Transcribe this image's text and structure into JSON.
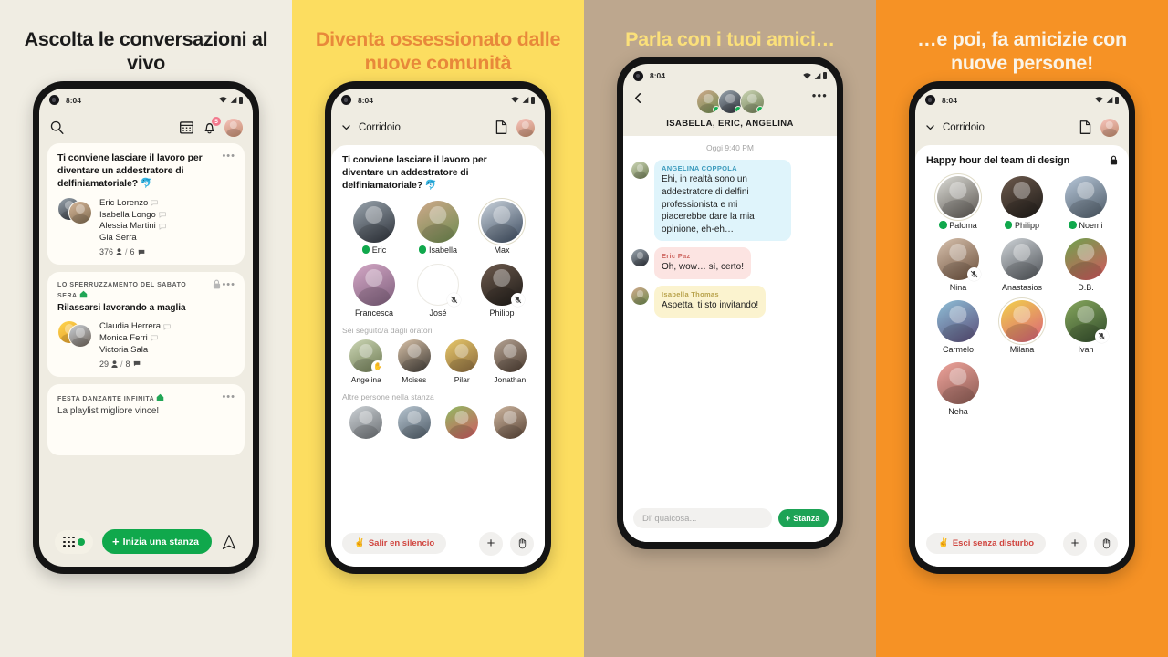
{
  "panels": [
    {
      "id": "panel-listen",
      "background": "#f0ede3",
      "headline": "Ascolta le conversazioni al vivo",
      "headline_color": "#1b1b1b"
    },
    {
      "id": "panel-communities",
      "background": "#fcdd60",
      "headline": "Diventa ossessionato dalle nuove comunità",
      "headline_color": "#e8883a"
    },
    {
      "id": "panel-friends",
      "background": "#bda78e",
      "headline": "Parla con i tuoi amici…",
      "headline_color": "#fbe07a"
    },
    {
      "id": "panel-newpeople",
      "background": "#f69225",
      "headline": "…e poi, fa amicizie con nuove persone!",
      "headline_color": "#faf4e8"
    }
  ],
  "status_bar": {
    "time": "8:04"
  },
  "phone1": {
    "appbar": {
      "search_icon": "search-icon",
      "calendar_icon": "calendar-icon",
      "bell_icon": "bell-icon",
      "bell_badge": "5",
      "avatar": "user-avatar"
    },
    "cards": [
      {
        "title": "Ti conviene lasciare il lavoro per diventare un addestratore di delfiniamatoriale? 🐬",
        "speakers": [
          "Eric Lorenzo",
          "Isabella Longo",
          "Alessia Martini",
          "Gia Serra"
        ],
        "listeners": "376",
        "comments": "6",
        "more": "•••"
      },
      {
        "eyebrow": "LO SFERRUZZAMENTO DEL SABATO SERA",
        "title": "Rilassarsi lavorando a maglia",
        "speakers": [
          "Claudia Herrera",
          "Monica Ferri",
          "Victoria Sala"
        ],
        "listeners": "29",
        "comments": "8",
        "locked": true,
        "more": "•••"
      },
      {
        "eyebrow": "FESTA DANZANTE INFINITA",
        "title": "La playlist migliore vince!",
        "more": "•••"
      }
    ],
    "bottom": {
      "start_room_label": "Inizia una stanza",
      "plus": "+",
      "plane_icon": "paper-plane-icon",
      "grid_icon": "grid-dots-icon"
    }
  },
  "phone2": {
    "appbar": {
      "title": "Corridoio",
      "chevron": "chevron-down-icon",
      "doc_icon": "document-icon",
      "avatar": "user-avatar"
    },
    "room_title": "Ti conviene lasciare il lavoro per diventare un addestratore di delfiniamatoriale? 🐬",
    "stage": [
      {
        "name": "Eric",
        "mic": "on"
      },
      {
        "name": "Isabella",
        "mic": "on"
      },
      {
        "name": "Max",
        "mic": "none",
        "ring": true
      },
      {
        "name": "Francesca",
        "mic": "none"
      },
      {
        "name": "José",
        "mic": "off",
        "empty": true
      },
      {
        "name": "Philipp",
        "mic": "off"
      }
    ],
    "followed_label": "Sei seguito/a dagli oratori",
    "followed": [
      "Angelina",
      "Moises",
      "Pilar",
      "Jonathan"
    ],
    "others_label": "Altre persone nella stanza",
    "others": [
      "p1",
      "p2",
      "p3",
      "p4"
    ],
    "bottom": {
      "leave_label": "Salir en silencio",
      "leave_emoji": "✌️",
      "plus": "+",
      "hand_icon": "raise-hand-icon"
    }
  },
  "phone3": {
    "header": {
      "back_icon": "back-arrow-icon",
      "more_icon": "more-options-icon",
      "title": "ISABELLA, ERIC, ANGELINA",
      "participants": [
        "Isabella",
        "Eric",
        "Angelina"
      ]
    },
    "date_divider": "Oggi 9:40 PM",
    "messages": [
      {
        "author": "ANGELINA COPPOLA",
        "text": "Ehi, in realtà sono un addestratore di delfini professionista e mi piacerebbe dare la mia opinione, eh-eh…",
        "tone": "blue"
      },
      {
        "author": "Eric Paz",
        "text": "Oh, wow… sì, certo!",
        "tone": "pink"
      },
      {
        "author": "Isabella Thomas",
        "text": "Aspetta, ti sto invitando!",
        "tone": "yellow"
      }
    ],
    "composer": {
      "placeholder": "Di' qualcosa...",
      "room_button": "Stanza",
      "room_plus": "+"
    }
  },
  "phone4": {
    "appbar": {
      "title": "Corridoio",
      "chevron": "chevron-down-icon",
      "doc_icon": "document-icon",
      "avatar": "user-avatar"
    },
    "room_title": "Happy hour del team di design",
    "locked": true,
    "people": [
      {
        "name": "Paloma",
        "mic": "on",
        "ring": true
      },
      {
        "name": "Philipp",
        "mic": "on"
      },
      {
        "name": "Noemi",
        "mic": "on"
      },
      {
        "name": "Nina",
        "mic": "off"
      },
      {
        "name": "Anastasios",
        "mic": "none"
      },
      {
        "name": "D.B.",
        "mic": "none"
      },
      {
        "name": "Carmelo",
        "mic": "none"
      },
      {
        "name": "Milana",
        "mic": "none",
        "ring": true
      },
      {
        "name": "Ivan",
        "mic": "off"
      },
      {
        "name": "Neha",
        "mic": "none"
      }
    ],
    "bottom": {
      "leave_label": "Esci senza disturbo",
      "leave_emoji": "✌️",
      "plus": "+",
      "hand_icon": "raise-hand-icon"
    }
  },
  "colors": {
    "green": "#10a84c",
    "red": "#d0453f",
    "badge": "#f2788c",
    "bubble_blue": "#dff4fb",
    "bubble_pink": "#fce4e2",
    "bubble_yellow": "#fbf3cf"
  }
}
